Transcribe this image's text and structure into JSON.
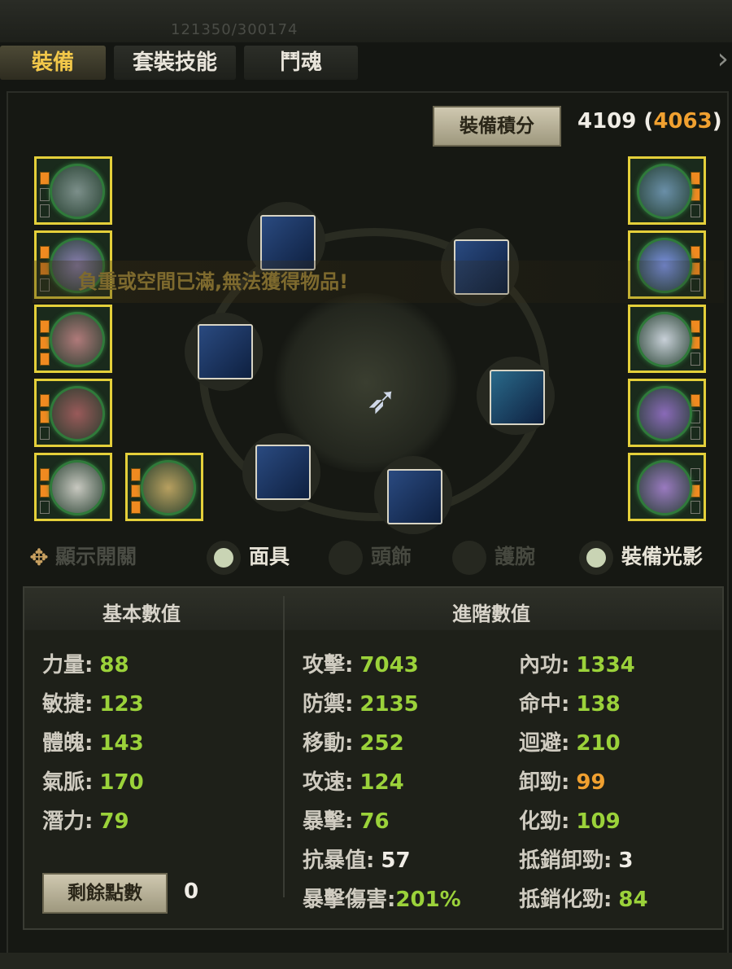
{
  "header": {
    "faint_text": "121350/300174"
  },
  "tabs": [
    {
      "label": "裝備",
      "active": true
    },
    {
      "label": "套裝技能",
      "active": false
    },
    {
      "label": "鬥魂",
      "active": false
    }
  ],
  "score": {
    "label": "裝備積分",
    "value": "4109",
    "bonus": "4063"
  },
  "warning": "負重或空間已滿,無法獲得物品!",
  "toggles": [
    {
      "label": "顯示開關",
      "icon": "flower-icon",
      "enabled": true
    },
    {
      "label": "面具",
      "enabled": true
    },
    {
      "label": "頭飾",
      "enabled": false
    },
    {
      "label": "護腕",
      "enabled": false
    },
    {
      "label": "裝備光影",
      "enabled": true
    }
  ],
  "stats": {
    "basic_title": "基本數值",
    "advanced_title": "進階數值",
    "basic": [
      {
        "label": "力量:",
        "value": "88"
      },
      {
        "label": "敏捷:",
        "value": "123"
      },
      {
        "label": "體魄:",
        "value": "143"
      },
      {
        "label": "氣脈:",
        "value": "170"
      },
      {
        "label": "潛力:",
        "value": "79"
      }
    ],
    "adv_left": [
      {
        "label": "攻擊:",
        "value": "7043"
      },
      {
        "label": "防禦:",
        "value": "2135"
      },
      {
        "label": "移動:",
        "value": "252"
      },
      {
        "label": "攻速:",
        "value": "124"
      },
      {
        "label": "暴擊:",
        "value": "76"
      },
      {
        "label": "抗暴值:",
        "value": "57"
      },
      {
        "label": "暴擊傷害:",
        "value": "201%"
      }
    ],
    "adv_right": [
      {
        "label": "內功:",
        "value": "1334"
      },
      {
        "label": "命中:",
        "value": "138"
      },
      {
        "label": "迴避:",
        "value": "210"
      },
      {
        "label": "卸勁:",
        "value": "99"
      },
      {
        "label": "化勁:",
        "value": "109"
      },
      {
        "label": "抵銷卸勁:",
        "value": "3"
      },
      {
        "label": "抵銷化勁:",
        "value": "84"
      }
    ],
    "remaining_label": "剩餘點數",
    "remaining_value": "0"
  }
}
